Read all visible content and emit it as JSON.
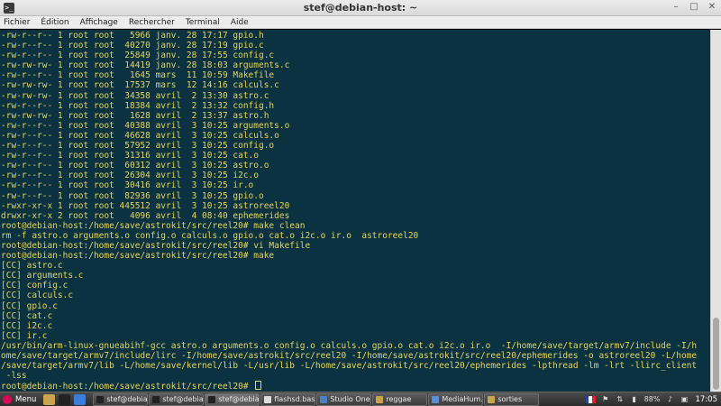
{
  "window": {
    "title": "stef@debian-host: ~",
    "app_icon_glyph": ">_",
    "minimize_glyph": "–",
    "maximize_glyph": "□",
    "close_glyph": "✕"
  },
  "menu": [
    "Fichier",
    "Édition",
    "Affichage",
    "Rechercher",
    "Terminal",
    "Aide"
  ],
  "terminal": {
    "colors": {
      "background": "#0a3240",
      "foreground": "#e6d55a"
    },
    "lines": [
      "-rw-r--r-- 1 root root   5966 janv. 28 17:17 gpio.h",
      "-rw-r--r-- 1 root root  40270 janv. 28 17:19 gpio.c",
      "-rw-r--r-- 1 root root  25849 janv. 28 17:55 config.c",
      "-rw-rw-rw- 1 root root  14419 janv. 28 18:03 arguments.c",
      "-rw-r--r-- 1 root root   1645 mars  11 10:59 Makefile",
      "-rw-rw-rw- 1 root root  17537 mars  12 14:16 calculs.c",
      "-rw-rw-rw- 1 root root  34358 avril  2 13:30 astro.c",
      "-rw-r--r-- 1 root root  18384 avril  2 13:32 config.h",
      "-rw-rw-rw- 1 root root   1628 avril  2 13:37 astro.h",
      "-rw-r--r-- 1 root root  40388 avril  3 10:25 arguments.o",
      "-rw-r--r-- 1 root root  46628 avril  3 10:25 calculs.o",
      "-rw-r--r-- 1 root root  57952 avril  3 10:25 config.o",
      "-rw-r--r-- 1 root root  31316 avril  3 10:25 cat.o",
      "-rw-r--r-- 1 root root  60312 avril  3 10:25 astro.o",
      "-rw-r--r-- 1 root root  26304 avril  3 10:25 i2c.o",
      "-rw-r--r-- 1 root root  30416 avril  3 10:25 ir.o",
      "-rw-r--r-- 1 root root  82936 avril  3 10:25 gpio.o",
      "-rwxr-xr-x 1 root root 445512 avril  3 10:25 astroreel20",
      "drwxr-xr-x 2 root root   4096 avril  4 08:40 ephemerides",
      "root@debian-host:/home/save/astrokit/src/reel20# make clean",
      "rm -f astro.o arguments.o config.o calculs.o gpio.o cat.o i2c.o ir.o  astroreel20",
      "root@debian-host:/home/save/astrokit/src/reel20# vi Makefile",
      "root@debian-host:/home/save/astrokit/src/reel20# make",
      "[CC] astro.c",
      "[CC] arguments.c",
      "[CC] config.c",
      "[CC] calculs.c",
      "[CC] gpio.c",
      "[CC] cat.c",
      "[CC] i2c.c",
      "[CC] ir.c",
      "/usr/bin/arm-linux-gnueabihf-gcc astro.o arguments.o config.o calculs.o gpio.o cat.o i2c.o ir.o  -I/home/save/target/armv7/include -I/h",
      "ome/save/target/armv7/include/lirc -I/home/save/astrokit/src/reel20 -I/home/save/astrokit/src/reel20/ephemerides -o astroreel20 -L/home",
      "/save/target/armv7/lib -L/home/save/kernel/lib -L/usr/lib -L/home/save/astrokit/src/reel20/ephemerides -lpthread -lm -lrt -llirc_client",
      " -lss"
    ],
    "prompt": "root@debian-host:/home/save/astrokit/src/reel20# "
  },
  "taskbar": {
    "menu_label": "Menu",
    "launchers": [
      {
        "name": "files-icon",
        "color": "#c9a44a"
      },
      {
        "name": "terminal-icon",
        "color": "#222222"
      },
      {
        "name": "browser-icon",
        "color": "#3b7dd8"
      }
    ],
    "tasks": [
      {
        "label": "stef@debia...",
        "icon_color": "#222222",
        "active": false
      },
      {
        "label": "stef@debia...",
        "icon_color": "#222222",
        "active": false
      },
      {
        "label": "stef@debia...",
        "icon_color": "#222222",
        "active": true
      },
      {
        "label": "flashsd.bas...",
        "icon_color": "#dcdcdc",
        "active": false
      },
      {
        "label": "Studio One...",
        "icon_color": "#4a7fc4",
        "active": false
      },
      {
        "label": "reggae",
        "icon_color": "#c9a44a",
        "active": false
      },
      {
        "label": "MediaHum...",
        "icon_color": "#5a8fd6",
        "active": false
      },
      {
        "label": "sorties",
        "icon_color": "#c9a44a",
        "active": false
      }
    ],
    "tray": {
      "battery": "88%",
      "clock": "17:05"
    }
  }
}
